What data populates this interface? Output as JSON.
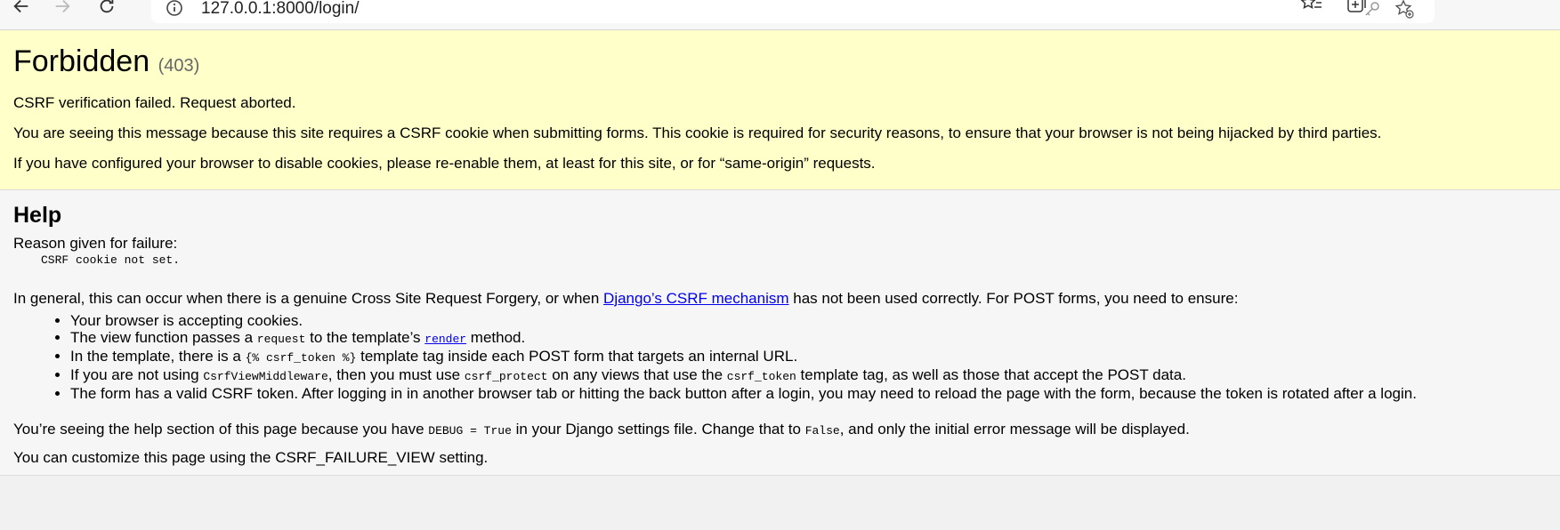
{
  "browser": {
    "url": "127.0.0.1:8000/login/"
  },
  "summary": {
    "title": "Forbidden",
    "code": "(403)",
    "msg1": "CSRF verification failed. Request aborted.",
    "msg2": "You are seeing this message because this site requires a CSRF cookie when submitting forms. This cookie is required for security reasons, to ensure that your browser is not being hijacked by third parties.",
    "msg3": "If you have configured your browser to disable cookies, please re-enable them, at least for this site, or for “same-origin” requests."
  },
  "help": {
    "title": "Help",
    "reason_label": "Reason given for failure:",
    "reason_value": "CSRF cookie not set.",
    "general_pre": "In general, this can occur when there is a genuine Cross Site Request Forgery, or when ",
    "general_link": "Django’s CSRF mechanism",
    "general_post": " has not been used correctly. For POST forms, you need to ensure:",
    "items": {
      "i1": "Your browser is accepting cookies.",
      "i2_a": "The view function passes a ",
      "i2_code": "request",
      "i2_b": " to the template’s ",
      "i2_link": "render",
      "i2_c": " method.",
      "i3_a": "In the template, there is a ",
      "i3_code": "{% csrf_token %}",
      "i3_b": " template tag inside each POST form that targets an internal URL.",
      "i4_a": "If you are not using ",
      "i4_code1": "CsrfViewMiddleware",
      "i4_b": ", then you must use ",
      "i4_code2": "csrf_protect",
      "i4_c": " on any views that use the ",
      "i4_code3": "csrf_token",
      "i4_d": " template tag, as well as those that accept the POST data.",
      "i5": "The form has a valid CSRF token. After logging in in another browser tab or hitting the back button after a login, you may need to reload the page with the form, because the token is rotated after a login."
    },
    "debug_a": "You’re seeing the help section of this page because you have ",
    "debug_code1": "DEBUG = True",
    "debug_b": " in your Django settings file. Change that to ",
    "debug_code2": "False",
    "debug_c": ", and only the initial error message will be displayed.",
    "customize": "You can customize this page using the CSRF_FAILURE_VIEW setting."
  }
}
